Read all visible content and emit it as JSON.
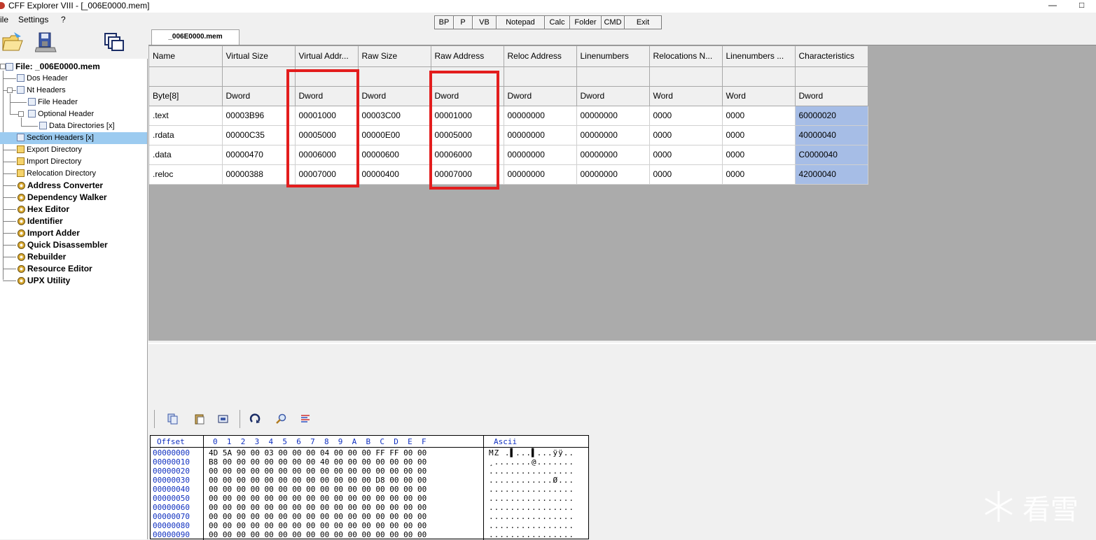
{
  "window": {
    "title": "CFF Explorer VIII - [_006E0000.mem]",
    "restore_glyph": "□",
    "min_glyph": "—"
  },
  "menu": [
    "ile",
    "Settings",
    "?"
  ],
  "toolbar": [
    "BP",
    "P",
    "VB",
    "Notepad",
    "Calc",
    "Folder",
    "CMD",
    "Exit"
  ],
  "tab": {
    "label": "_006E0000.mem"
  },
  "tree": {
    "root": "File: _006E0000.mem",
    "items": [
      {
        "label": "Dos Header"
      },
      {
        "label": "Nt Headers"
      },
      {
        "label": "File Header"
      },
      {
        "label": "Optional Header"
      },
      {
        "label": "Data Directories [x]"
      },
      {
        "label": "Section Headers [x]"
      },
      {
        "label": "Export Directory"
      },
      {
        "label": "Import Directory"
      },
      {
        "label": "Relocation Directory"
      }
    ],
    "tools": [
      "Address Converter",
      "Dependency Walker",
      "Hex Editor",
      "Identifier",
      "Import Adder",
      "Quick Disassembler",
      "Rebuilder",
      "Resource Editor",
      "UPX Utility"
    ]
  },
  "sections": {
    "columns": [
      "Name",
      "Virtual Size",
      "Virtual Addr...",
      "Raw Size",
      "Raw Address",
      "Reloc Address",
      "Linenumbers",
      "Relocations N...",
      "Linenumbers ...",
      "Characteristics"
    ],
    "types": [
      "Byte[8]",
      "Dword",
      "Dword",
      "Dword",
      "Dword",
      "Dword",
      "Dword",
      "Word",
      "Word",
      "Dword"
    ],
    "rows": [
      [
        ".text",
        "00003B96",
        "00001000",
        "00003C00",
        "00001000",
        "00000000",
        "00000000",
        "0000",
        "0000",
        "60000020"
      ],
      [
        ".rdata",
        "00000C35",
        "00005000",
        "00000E00",
        "00005000",
        "00000000",
        "00000000",
        "0000",
        "0000",
        "40000040"
      ],
      [
        ".data",
        "00000470",
        "00006000",
        "00000600",
        "00006000",
        "00000000",
        "00000000",
        "0000",
        "0000",
        "C0000040"
      ],
      [
        ".reloc",
        "00000388",
        "00007000",
        "00000400",
        "00007000",
        "00000000",
        "00000000",
        "0000",
        "0000",
        "42000040"
      ]
    ]
  },
  "hex": {
    "offset_header": "Offset",
    "byte_header": "0  1  2  3  4  5  6  7  8  9  A  B  C  D  E  F",
    "ascii_header": "Ascii",
    "offsets": [
      "00000000",
      "00000010",
      "00000020",
      "00000030",
      "00000040",
      "00000050",
      "00000060",
      "00000070",
      "00000080",
      "00000090"
    ],
    "bytes": [
      "4D 5A 90 00 03 00 00 00 04 00 00 00 FF FF 00 00",
      "B8 00 00 00 00 00 00 00 40 00 00 00 00 00 00 00",
      "00 00 00 00 00 00 00 00 00 00 00 00 00 00 00 00",
      "00 00 00 00 00 00 00 00 00 00 00 00 D8 00 00 00",
      "00 00 00 00 00 00 00 00 00 00 00 00 00 00 00 00",
      "00 00 00 00 00 00 00 00 00 00 00 00 00 00 00 00",
      "00 00 00 00 00 00 00 00 00 00 00 00 00 00 00 00",
      "00 00 00 00 00 00 00 00 00 00 00 00 00 00 00 00",
      "00 00 00 00 00 00 00 00 00 00 00 00 00 00 00 00",
      "00 00 00 00 00 00 00 00 00 00 00 00 00 00 00 00"
    ],
    "ascii": [
      "MZ .▌...▌...ÿÿ..",
      "¸.......@.......",
      "................",
      "............Ø...",
      "................",
      "................",
      "................",
      "................",
      "................",
      "................"
    ]
  },
  "watermark": "看雪"
}
